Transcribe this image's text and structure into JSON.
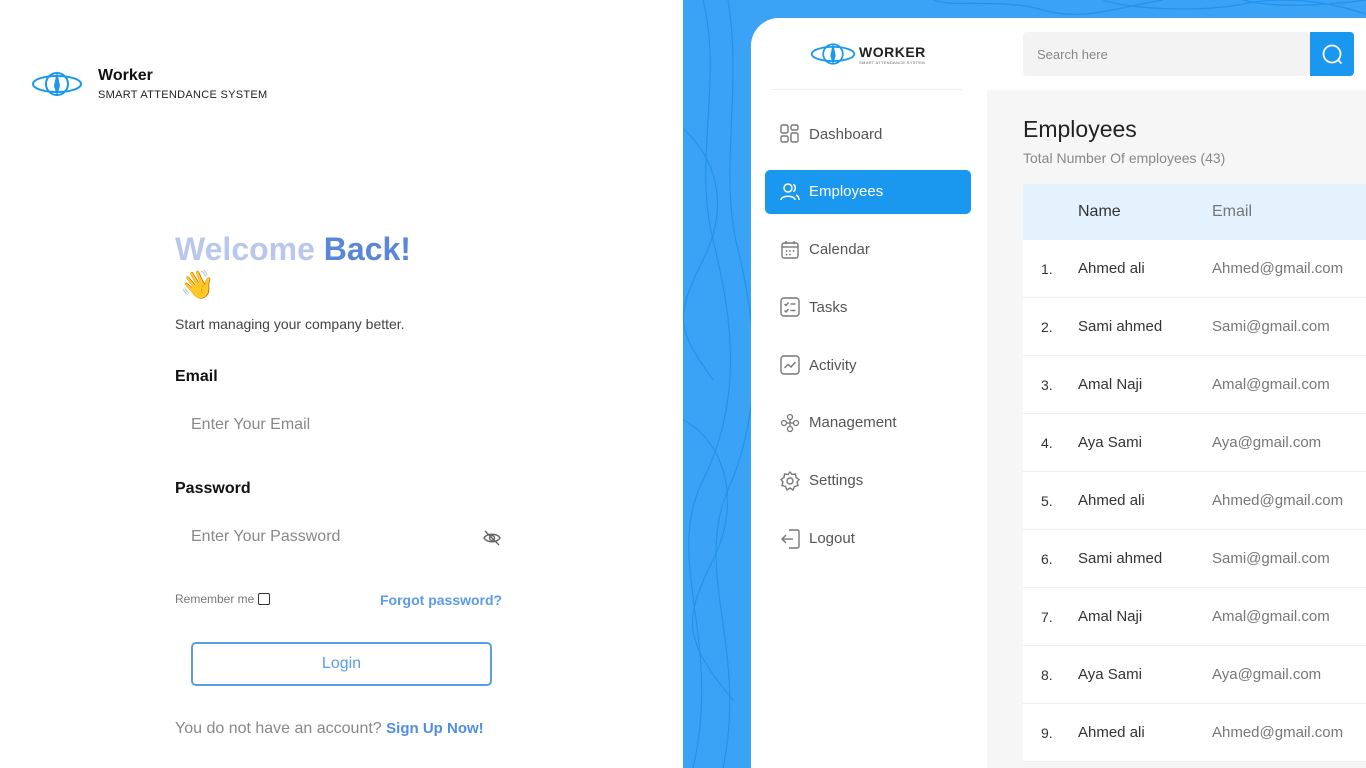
{
  "brand": {
    "name": "Worker",
    "tagline": "SMART ATTENDANCE SYSTEM"
  },
  "login": {
    "welcome_part1": "Welcome",
    "welcome_part2": "Back!",
    "wave_emoji": "👋",
    "subtitle": "Start managing your company better.",
    "email_label": "Email",
    "email_placeholder": "Enter Your Email",
    "email_value": "",
    "password_label": "Password",
    "password_placeholder": "Enter Your Password",
    "password_value": "",
    "remember_label": "Remember me",
    "remember_checked": false,
    "forgot_label": "Forgot password?",
    "login_label": "Login",
    "no_account_text": "You do not have an account?",
    "signup_label": "Sign Up Now!"
  },
  "preview": {
    "logo_name": "WORKER",
    "logo_sub": "SMART ATTENDANCE SYSTEM",
    "search_placeholder": "Search here",
    "nav": [
      {
        "label": "Dashboard",
        "icon": "grid-icon",
        "active": false
      },
      {
        "label": "Employees",
        "icon": "users-icon",
        "active": true
      },
      {
        "label": "Calendar",
        "icon": "calendar-icon",
        "active": false
      },
      {
        "label": "Tasks",
        "icon": "tasks-icon",
        "active": false
      },
      {
        "label": "Activity",
        "icon": "activity-icon",
        "active": false
      },
      {
        "label": "Management",
        "icon": "management-icon",
        "active": false
      },
      {
        "label": "Settings",
        "icon": "gear-icon",
        "active": false
      },
      {
        "label": "Logout",
        "icon": "logout-icon",
        "active": false
      }
    ],
    "employees_title": "Employees",
    "employees_subtitle": "Total Number Of employees (43)",
    "table": {
      "columns": [
        "Name",
        "Email"
      ],
      "rows": [
        {
          "idx": "1.",
          "name": "Ahmed ali",
          "email": "Ahmed@gmail.com"
        },
        {
          "idx": "2.",
          "name": "Sami ahmed",
          "email": "Sami@gmail.com"
        },
        {
          "idx": "3.",
          "name": "Amal Naji",
          "email": "Amal@gmail.com"
        },
        {
          "idx": "4.",
          "name": "Aya Sami",
          "email": "Aya@gmail.com"
        },
        {
          "idx": "5.",
          "name": "Ahmed ali",
          "email": "Ahmed@gmail.com"
        },
        {
          "idx": "6.",
          "name": "Sami ahmed",
          "email": "Sami@gmail.com"
        },
        {
          "idx": "7.",
          "name": "Amal Naji",
          "email": "Amal@gmail.com"
        },
        {
          "idx": "8.",
          "name": "Aya Sami",
          "email": "Aya@gmail.com"
        },
        {
          "idx": "9.",
          "name": "Ahmed ali",
          "email": "Ahmed@gmail.com"
        }
      ]
    }
  },
  "colors": {
    "accent": "#1a98f0",
    "link": "#5b9be8",
    "welcome_light": "#b8c7ea",
    "welcome_dark": "#5b86d8",
    "panel_bg": "#3aa3f5"
  }
}
